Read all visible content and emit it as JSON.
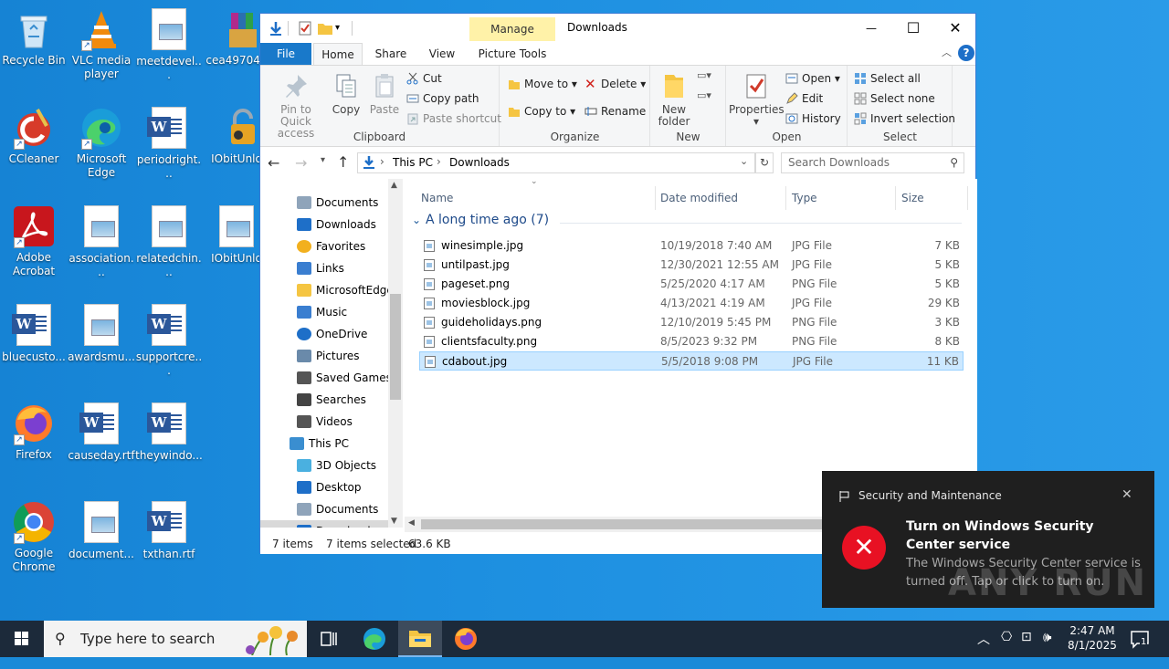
{
  "desktop": {
    "icons": [
      {
        "label": "Recycle Bin"
      },
      {
        "label": "VLC media player"
      },
      {
        "label": "meetdevel..."
      },
      {
        "label": "cea497043"
      },
      {
        "label": "CCleaner"
      },
      {
        "label": "Microsoft Edge"
      },
      {
        "label": "periodright..."
      },
      {
        "label": "IObitUnlo"
      },
      {
        "label": "Adobe Acrobat"
      },
      {
        "label": "association..."
      },
      {
        "label": "relatedchin..."
      },
      {
        "label": "IObitUnlo"
      },
      {
        "label": "bluecusto..."
      },
      {
        "label": "awardsmu..."
      },
      {
        "label": "supportcre..."
      },
      {
        "label": "Firefox"
      },
      {
        "label": "causeday.rtf"
      },
      {
        "label": "theywindo..."
      },
      {
        "label": "Google Chrome"
      },
      {
        "label": "document..."
      },
      {
        "label": "txthan.rtf"
      }
    ]
  },
  "explorer": {
    "title": "Downloads",
    "manage_tab": "Manage",
    "contextual_tab": "Picture Tools",
    "window_controls": {
      "minimize": "—",
      "maximize": "☐",
      "close": "✕"
    },
    "tabs": {
      "file": "File",
      "home": "Home",
      "share": "Share",
      "view": "View"
    },
    "ribbon": {
      "clipboard": {
        "label": "Clipboard",
        "pin": "Pin to Quick access",
        "copy": "Copy",
        "paste": "Paste",
        "cut": "Cut",
        "copy_path": "Copy path",
        "paste_shortcut": "Paste shortcut"
      },
      "organize": {
        "label": "Organize",
        "move_to": "Move to",
        "copy_to": "Copy to",
        "delete": "Delete",
        "rename": "Rename"
      },
      "new": {
        "label": "New",
        "new_folder": "New folder"
      },
      "open": {
        "label": "Open",
        "properties": "Properties",
        "open": "Open",
        "edit": "Edit",
        "history": "History"
      },
      "select": {
        "label": "Select",
        "select_all": "Select all",
        "select_none": "Select none",
        "invert": "Invert selection"
      }
    },
    "address": {
      "crumbs": [
        "This PC",
        "Downloads"
      ],
      "search_placeholder": "Search Downloads"
    },
    "nav": [
      {
        "label": "Documents",
        "icon": "documents-icon"
      },
      {
        "label": "Downloads",
        "icon": "downloads-icon"
      },
      {
        "label": "Favorites",
        "icon": "favorites-icon"
      },
      {
        "label": "Links",
        "icon": "links-icon"
      },
      {
        "label": "MicrosoftEdge",
        "icon": "folder-icon"
      },
      {
        "label": "Music",
        "icon": "music-icon"
      },
      {
        "label": "OneDrive",
        "icon": "onedrive-icon"
      },
      {
        "label": "Pictures",
        "icon": "pictures-icon"
      },
      {
        "label": "Saved Games",
        "icon": "saved-games-icon"
      },
      {
        "label": "Searches",
        "icon": "searches-icon"
      },
      {
        "label": "Videos",
        "icon": "videos-icon"
      },
      {
        "label": "This PC",
        "icon": "this-pc-icon"
      },
      {
        "label": "3D Objects",
        "icon": "3d-objects-icon"
      },
      {
        "label": "Desktop",
        "icon": "desktop-icon"
      },
      {
        "label": "Documents",
        "icon": "documents-icon"
      },
      {
        "label": "Downloads",
        "icon": "downloads-icon"
      }
    ],
    "columns": {
      "name": "Name",
      "date": "Date modified",
      "type": "Type",
      "size": "Size"
    },
    "group_header": "A long time ago (7)",
    "files": [
      {
        "name": "winesimple.jpg",
        "date": "10/19/2018 7:40 AM",
        "type": "JPG File",
        "size": "7 KB"
      },
      {
        "name": "untilpast.jpg",
        "date": "12/30/2021 12:55 AM",
        "type": "JPG File",
        "size": "5 KB"
      },
      {
        "name": "pageset.png",
        "date": "5/25/2020 4:17 AM",
        "type": "PNG File",
        "size": "5 KB"
      },
      {
        "name": "moviesblock.jpg",
        "date": "4/13/2021 4:19 AM",
        "type": "JPG File",
        "size": "29 KB"
      },
      {
        "name": "guideholidays.png",
        "date": "12/10/2019 5:45 PM",
        "type": "PNG File",
        "size": "3 KB"
      },
      {
        "name": "clientsfaculty.png",
        "date": "8/5/2023 9:32 PM",
        "type": "PNG File",
        "size": "8 KB"
      },
      {
        "name": "cdabout.jpg",
        "date": "5/5/2018 9:08 PM",
        "type": "JPG File",
        "size": "11 KB"
      }
    ],
    "status": {
      "items": "7 items",
      "selected": "7 items selected",
      "size": "63.6 KB"
    }
  },
  "toast": {
    "app": "Security and Maintenance",
    "title": "Turn on Windows Security Center service",
    "body": "The Windows Security Center service is turned off. Tap or click to turn on.",
    "watermark": "ANY RUN"
  },
  "taskbar": {
    "search_placeholder": "Type here to search",
    "time": "2:47 AM",
    "date": "8/1/2025",
    "notification_count": "1"
  }
}
